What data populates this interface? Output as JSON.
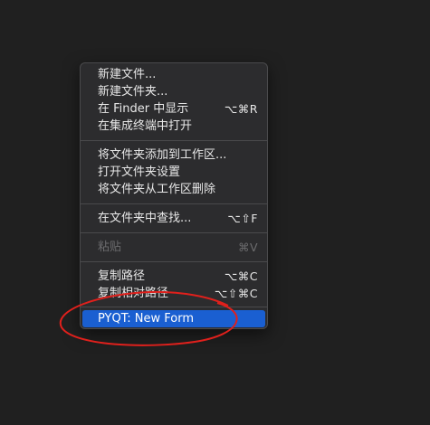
{
  "menu": {
    "groups": [
      [
        {
          "label": "新建文件...",
          "shortcut": ""
        },
        {
          "label": "新建文件夹...",
          "shortcut": ""
        },
        {
          "label": "在 Finder 中显示",
          "shortcut": "⌥⌘R"
        },
        {
          "label": "在集成终端中打开",
          "shortcut": ""
        }
      ],
      [
        {
          "label": "将文件夹添加到工作区...",
          "shortcut": ""
        },
        {
          "label": "打开文件夹设置",
          "shortcut": ""
        },
        {
          "label": "将文件夹从工作区删除",
          "shortcut": ""
        }
      ],
      [
        {
          "label": "在文件夹中查找...",
          "shortcut": "⌥⇧F"
        }
      ],
      [
        {
          "label": "粘贴",
          "shortcut": "⌘V",
          "disabled": true
        }
      ],
      [
        {
          "label": "复制路径",
          "shortcut": "⌥⌘C"
        },
        {
          "label": "复制相对路径",
          "shortcut": "⌥⇧⌘C"
        }
      ],
      [
        {
          "label": "PYQT: New Form",
          "shortcut": "",
          "selected": true
        }
      ]
    ]
  },
  "colors": {
    "background": "#202020",
    "menu_bg": "#2c2c2e",
    "selection": "#1a5fd1",
    "annotation": "#e0201c"
  }
}
